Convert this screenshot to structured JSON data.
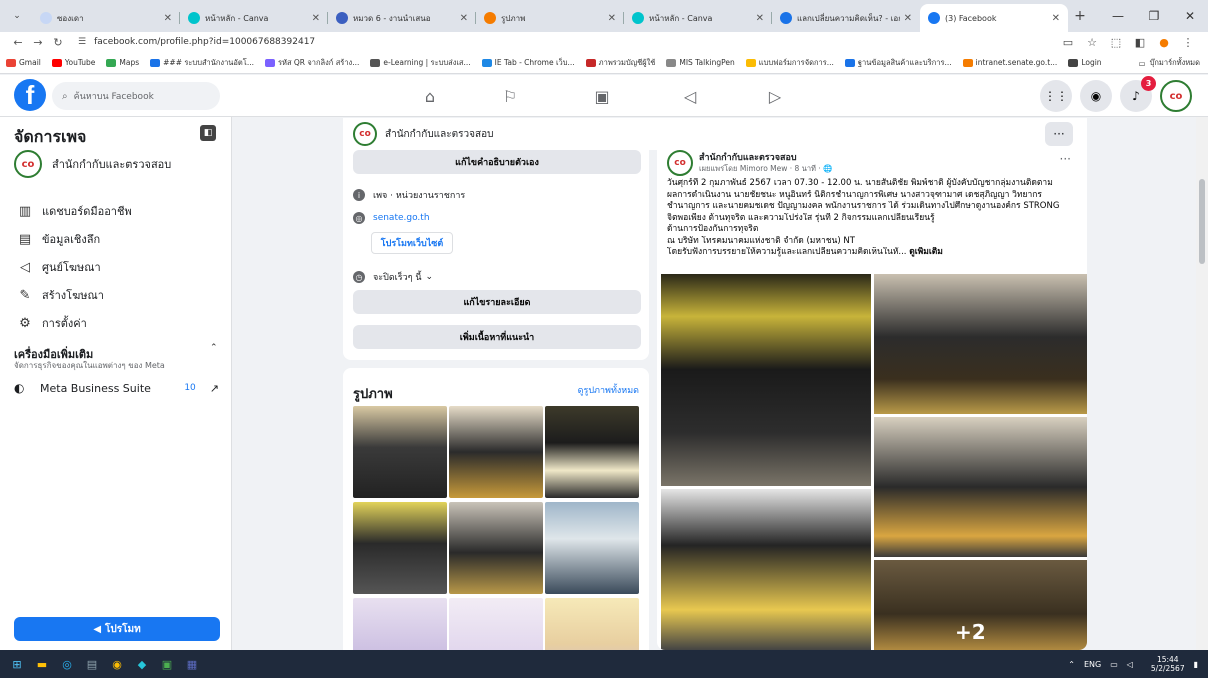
{
  "browser": {
    "tabs": [
      {
        "title": "ซองเดา",
        "color": "#c7d7f5"
      },
      {
        "title": "หน้าหลัก - Canva",
        "color": "#00c4cc"
      },
      {
        "title": "หมวด 6 - งานนำเสนอ",
        "color": "#3b5fc0"
      },
      {
        "title": "รูปภาพ",
        "color": "#f57c00"
      },
      {
        "title": "หน้าหลัก - Canva",
        "color": "#00c4cc"
      },
      {
        "title": "แลกเปลี่ยนความคิดเห็น? - เอกสาร",
        "color": "#1a73e8"
      },
      {
        "title": "(3) Facebook",
        "color": "#1877f2"
      }
    ],
    "url": "facebook.com/profile.php?id=100067688392417",
    "bookmarks": [
      {
        "label": "Gmail",
        "color": "#ea4335"
      },
      {
        "label": "YouTube",
        "color": "#ff0000"
      },
      {
        "label": "Maps",
        "color": "#34a853"
      },
      {
        "label": "### ระบบสำนักงานอัตโ...",
        "color": "#1a73e8"
      },
      {
        "label": "รหัส QR จากลิงก์ สร้าง...",
        "color": "#7b61ff"
      },
      {
        "label": "e-Learning | ระบบส่งเส...",
        "color": "#555555"
      },
      {
        "label": "IE Tab - Chrome เว็บ...",
        "color": "#1e88e5"
      },
      {
        "label": "ภาพรวมบัญชีผู้ใช้",
        "color": "#c62828"
      },
      {
        "label": "MIS TalkingPen",
        "color": "#888888"
      },
      {
        "label": "แบบฟอร์มการจัดการ...",
        "color": "#fbbc04"
      },
      {
        "label": "ฐานข้อมูลสินค้าและบริการ...",
        "color": "#1a73e8"
      },
      {
        "label": "intranet.senate.go.t...",
        "color": "#f57c00"
      },
      {
        "label": "Login",
        "color": "#444444"
      }
    ],
    "bookmarks_right": "บุ๊กมาร์กทั้งหมด"
  },
  "fb": {
    "search_placeholder": "ค้นหาบน Facebook",
    "notif_count": "3",
    "sidebar": {
      "title": "จัดการเพจ",
      "page_name": "สำนักกำกับและตรวจสอบ",
      "items": [
        {
          "label": "แดชบอร์ดมืออาชีพ",
          "icon": "dashboard-icon"
        },
        {
          "label": "ข้อมูลเชิงลึก",
          "icon": "insights-icon"
        },
        {
          "label": "ศูนย์โฆษณา",
          "icon": "megaphone-icon"
        },
        {
          "label": "สร้างโฆษณา",
          "icon": "edit-icon"
        },
        {
          "label": "การตั้งค่า",
          "icon": "gear-icon"
        }
      ],
      "tools_title": "เครื่องมือเพิ่มเติม",
      "tools_sub": "จัดการธุรกิจของคุณในแอพต่างๆ ของ Meta",
      "mbs_label": "Meta Business Suite",
      "mbs_count": "10",
      "promote": "โปรโมท"
    },
    "pagebar": {
      "name": "สำนักกำกับและตรวจสอบ"
    },
    "intro": {
      "edit_bio": "แก้ไขคำอธิบายตัวเอง",
      "category": "เพจ · หน่วยงานราชการ",
      "website": "senate.go.th",
      "promote_website": "โปรโมทเว็บไซต์",
      "hours": "จะปิดเร็วๆ นี้",
      "edit_details": "แก้ไขรายละเอียด",
      "add_featured": "เพิ่มเนื้อหาที่แนะนำ"
    },
    "photos": {
      "title": "รูปภาพ",
      "see_all": "ดูรูปภาพทั้งหมด"
    },
    "post": {
      "author": "สำนักกำกับและตรวจสอบ",
      "meta": "เผยแพร่โดย Mimoro Mew · 8 นาที · 🌐",
      "lines": [
        "วันศุกร์ที่ 2 กุมภาพันธ์ 2567 เวลา 07.30 - 12.00 น. นายสันติชัย  พิมพ์ชาติ ผู้บังคับบัญชากลุ่มงานติดตาม",
        "ผลการดำเนินงาน นายชัยชนะ  หนูอินทร์ นิติกรชำนาญการพิเศษ นางสาวจุฑามาศ  เดชสุภิญญา วิทยากร",
        "ชำนาญการ และนายคมชเดช  ปัญญามงคล พนักงานราชการ ได้ ร่วมเดินทางไปศึกษาดูงานองค์กร STRONG",
        "จิตพอเพียง ต้านทุจริต และความโปร่งใส รุ่นที่ 2 กิจกรรมแลกเปลี่ยนเรียนรู้",
        "ด้านการป้องกันการทุจริต",
        "ณ บริษัท โทรคมนาคมแห่งชาติ จำกัด (มหาชน) NT",
        "   โดยรับฟังการบรรยายให้ความรู้และแลกเปลี่ยนความคิดเห็นในหั..."
      ],
      "see_more": "ดูเพิ่มเติม",
      "more_photos": "+2"
    }
  },
  "taskbar": {
    "lang": "ENG",
    "time": "15:44",
    "date": "5/2/2567"
  }
}
